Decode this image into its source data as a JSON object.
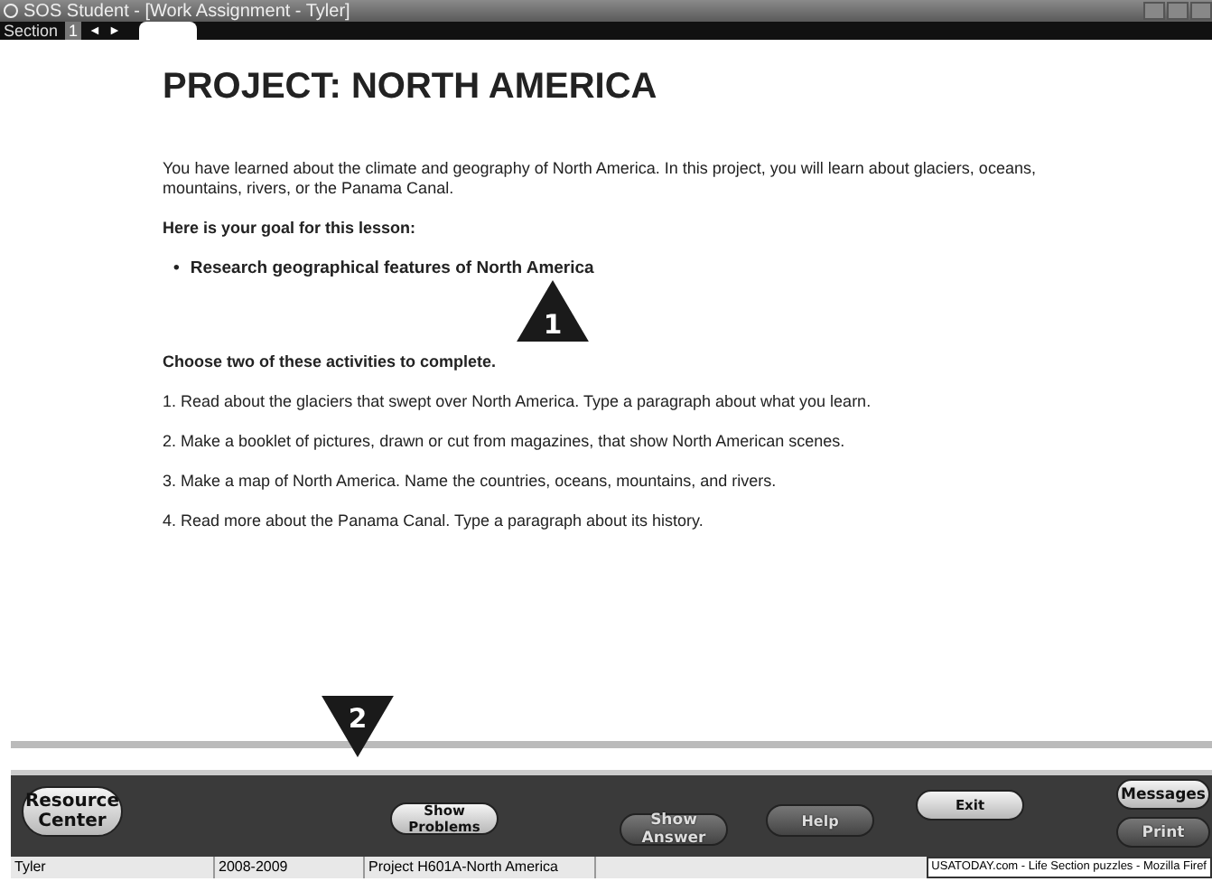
{
  "window": {
    "title": "SOS Student - [Work Assignment - Tyler]"
  },
  "section_bar": {
    "label": "Section",
    "number": "1",
    "prev": "◄",
    "next": "►"
  },
  "lesson": {
    "title": "PROJECT: NORTH AMERICA",
    "intro": "You have learned about the climate and geography of North America. In this project, you will learn about glaciers, oceans, mountains, rivers, or the Panama Canal.",
    "goal_heading": "Here is your goal for this lesson:",
    "goal_bullet": "•",
    "goals": [
      "Research geographical features of North America"
    ],
    "activities_heading": "Choose two of these activities to complete.",
    "activities": [
      "1. Read about the glaciers that swept over North America. Type a paragraph about what you learn.",
      "2. Make a booklet of pictures, drawn or cut from magazines, that show North American scenes.",
      "3. Make a map of North America. Name the countries, oceans, mountains, and rivers.",
      "4. Read more about the Panama Canal. Type a paragraph about its history."
    ]
  },
  "callouts": [
    "1",
    "2"
  ],
  "toolbar": [
    {
      "label": "Resource Center",
      "kind": "light"
    },
    {
      "label": "Show Problems",
      "kind": "light"
    },
    {
      "label": "Show Answer",
      "kind": "dark"
    },
    {
      "label": "Help",
      "kind": "dark"
    },
    {
      "label": "Exit",
      "kind": "light"
    },
    {
      "label": "Messages",
      "kind": "light"
    },
    {
      "label": "Print",
      "kind": "dark"
    }
  ],
  "status_bar": [
    "Tyler",
    "2008-2009",
    "Project H601A-North America"
  ],
  "taskbar_item": "USATODAY.com - Life Section puzzles - Mozilla Firef"
}
